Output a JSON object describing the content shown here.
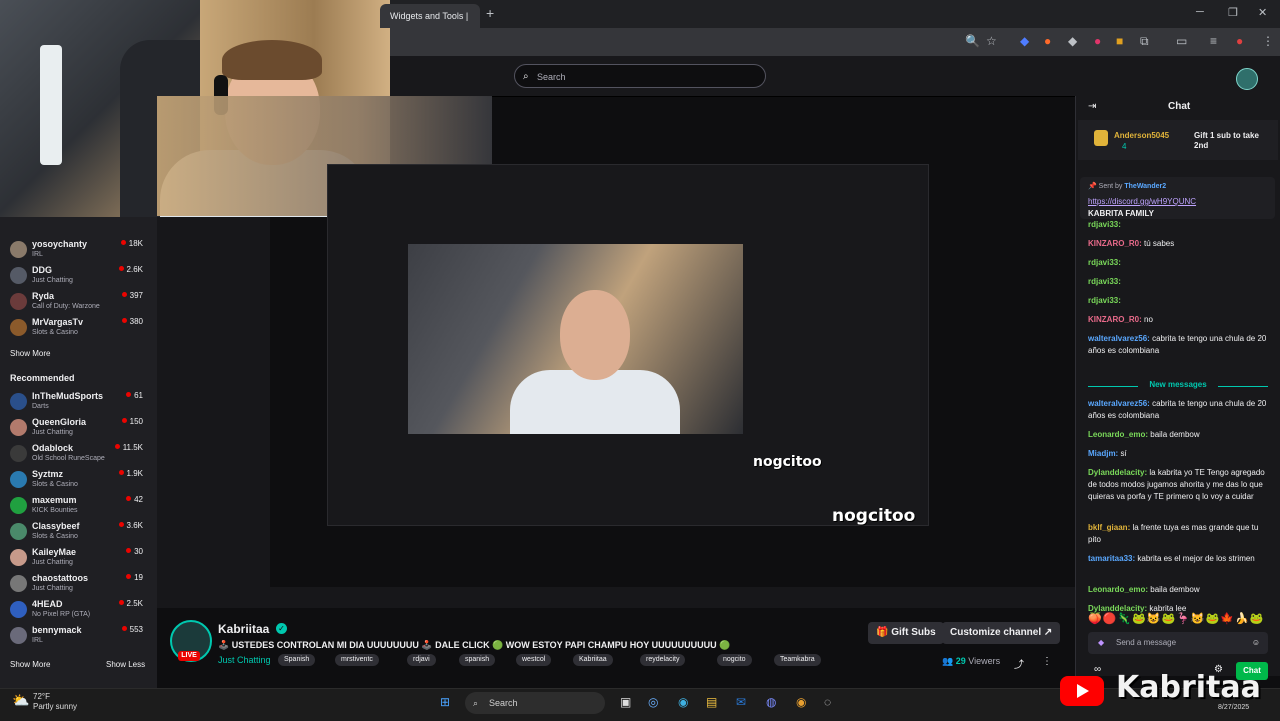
{
  "browser": {
    "tab_title": "Widgets and Tools |",
    "new_tab": "+",
    "min": "─",
    "max": "❐",
    "close": "✕"
  },
  "twitch": {
    "search_placeholder": "Search"
  },
  "sidebar": {
    "followed": [
      {
        "name": "yosoychanty",
        "game": "IRL",
        "viewers": "18K",
        "color": "#8a7a6a"
      },
      {
        "name": "DDG",
        "game": "Just Chatting",
        "viewers": "2.6K",
        "color": "#555a66"
      },
      {
        "name": "Ryda",
        "game": "Call of Duty: Warzone",
        "viewers": "397",
        "color": "#6b3b3b"
      },
      {
        "name": "MrVargasTv",
        "game": "Slots & Casino",
        "viewers": "380",
        "color": "#8b5a2b"
      }
    ],
    "show_more": "Show More",
    "recommended_title": "Recommended",
    "recommended": [
      {
        "name": "InTheMudSports",
        "game": "Darts",
        "viewers": "61",
        "color": "#2a4f8a"
      },
      {
        "name": "QueenGloria",
        "game": "Just Chatting",
        "viewers": "150",
        "color": "#b27a6c"
      },
      {
        "name": "Odablock",
        "game": "Old School RuneScape",
        "viewers": "11.5K",
        "color": "#3a3a3a"
      },
      {
        "name": "Syztmz",
        "game": "Slots & Casino",
        "viewers": "1.9K",
        "color": "#2a7ab0"
      },
      {
        "name": "maxemum",
        "game": "KICK Bounties",
        "viewers": "42",
        "color": "#20a040"
      },
      {
        "name": "Classybeef",
        "game": "Slots & Casino",
        "viewers": "3.6K",
        "color": "#4a8a6a"
      },
      {
        "name": "KaileyMae",
        "game": "Just Chatting",
        "viewers": "30",
        "color": "#c79a8a"
      },
      {
        "name": "chaostattoos",
        "game": "Just Chatting",
        "viewers": "19",
        "color": "#777"
      },
      {
        "name": "4HEAD",
        "game": "No Pixel RP (GTA)",
        "viewers": "2.5K",
        "color": "#2f5fbf"
      },
      {
        "name": "bennymack",
        "game": "IRL",
        "viewers": "553",
        "color": "#6a6a7a"
      }
    ],
    "show_more_2": "Show More",
    "show_less": "Show Less"
  },
  "stream": {
    "channel": "Kabriitaa",
    "live": "LIVE",
    "title": "🕹️ USTEDES CONTROLAN MI DIA UUUUUUUU 🕹️ DALE CLICK 🟢 WOW ESTOY PAPI CHAMPU HOY UUUUUUUUUU 🟢",
    "game": "Just Chatting",
    "tags": [
      "Spanish",
      "mrstiventc",
      "rdjavi",
      "spanish",
      "westcol",
      "Kabriitaa",
      "reydelacity",
      "nogcito",
      "Teamkabra"
    ],
    "gift_subs": "Gift Subs",
    "customize": "Customize channel",
    "viewers_count": "29",
    "viewers_label": "Viewers",
    "overlay_text": "nogcitoo"
  },
  "chat": {
    "title": "Chat",
    "hype_user": "Anderson5045",
    "hype_count": "4",
    "hype_goal": "Gift 1 sub to take 2nd",
    "pinned_by_prefix": "Sent by",
    "pinned_by": "TheWander2",
    "pinned_link": "https://discord.gg/wH9YQUNC",
    "pinned_text": "KABRITA FAMILY",
    "messages": [
      {
        "user": "rdjavi33:",
        "text": "",
        "color": "#7ad95a"
      },
      {
        "user": "KINZARO_R0:",
        "text": "tú sabes",
        "color": "#e86a8a"
      },
      {
        "user": "rdjavi33:",
        "text": "",
        "color": "#7ad95a"
      },
      {
        "user": "rdjavi33:",
        "text": "",
        "color": "#7ad95a"
      },
      {
        "user": "rdjavi33:",
        "text": "",
        "color": "#7ad95a"
      },
      {
        "user": "KINZARO_R0:",
        "text": "no",
        "color": "#e86a8a"
      },
      {
        "user": "walteralvarez56:",
        "text": "cabrita te tengo una chula de 20 años es colombiana",
        "color": "#5aa8ff"
      }
    ],
    "new_messages": "New messages",
    "messages2": [
      {
        "user": "walteralvarez56:",
        "text": "cabrita te tengo una chula de 20 años es colombiana",
        "color": "#5aa8ff"
      },
      {
        "user": "Leonardo_emo:",
        "text": "baila dembow",
        "color": "#7ad95a"
      },
      {
        "user": "Miadjm:",
        "text": "sí",
        "color": "#5aa8ff"
      },
      {
        "user": "Dylanddelacity:",
        "text": "la kabrita yo TE Tengo agregado de todos modos jugamos ahorita y me das lo que quieras va porfa y TE primero q lo voy a cuidar",
        "color": "#7ad95a"
      },
      {
        "user": "bklf_giaan:",
        "text": "la frente tuya es mas grande que tu pito",
        "color": "#e0b33a"
      },
      {
        "user": "tamaritaa33:",
        "text": "kabrita es el mejor de los strimen",
        "color": "#5aa8ff"
      },
      {
        "user": "Leonardo_emo:",
        "text": "baila dembow",
        "color": "#7ad95a"
      },
      {
        "user": "Dylanddelacity:",
        "text": "kabrita lee",
        "color": "#7ad95a"
      }
    ],
    "emotes": "🍑🔴🦎🐸😺🐸🦩😺🐸🍁🍌🐸",
    "send_placeholder": "Send a message",
    "chat_button": "Chat",
    "points": "∞"
  },
  "taskbar": {
    "search": "Search",
    "temp": "72°F",
    "weather": "Partly sunny",
    "date": "8/27/2025"
  },
  "watermark": {
    "brand": "Kabritaa"
  }
}
